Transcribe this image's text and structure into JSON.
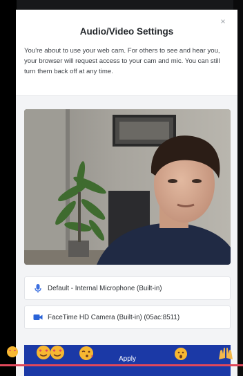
{
  "modal": {
    "title": "Audio/Video Settings",
    "description": "You're about to use your web cam. For others to see and hear you, your browser will request access to your cam and mic. You can still turn them back off at any time.",
    "close_symbol": "×"
  },
  "devices": {
    "microphone": {
      "label": "Default - Internal Microphone (Built-in)",
      "icon": "microphone-icon"
    },
    "camera": {
      "label": "FaceTime HD Camera (Built-in) (05ac:8511)",
      "icon": "video-camera-icon"
    }
  },
  "apply_button": {
    "label": "Apply"
  },
  "colors": {
    "accent": "#1b39a6",
    "mic_icon": "#3b6fe0",
    "camera_icon": "#2a63d8",
    "reaction_line": "#e0485b"
  }
}
